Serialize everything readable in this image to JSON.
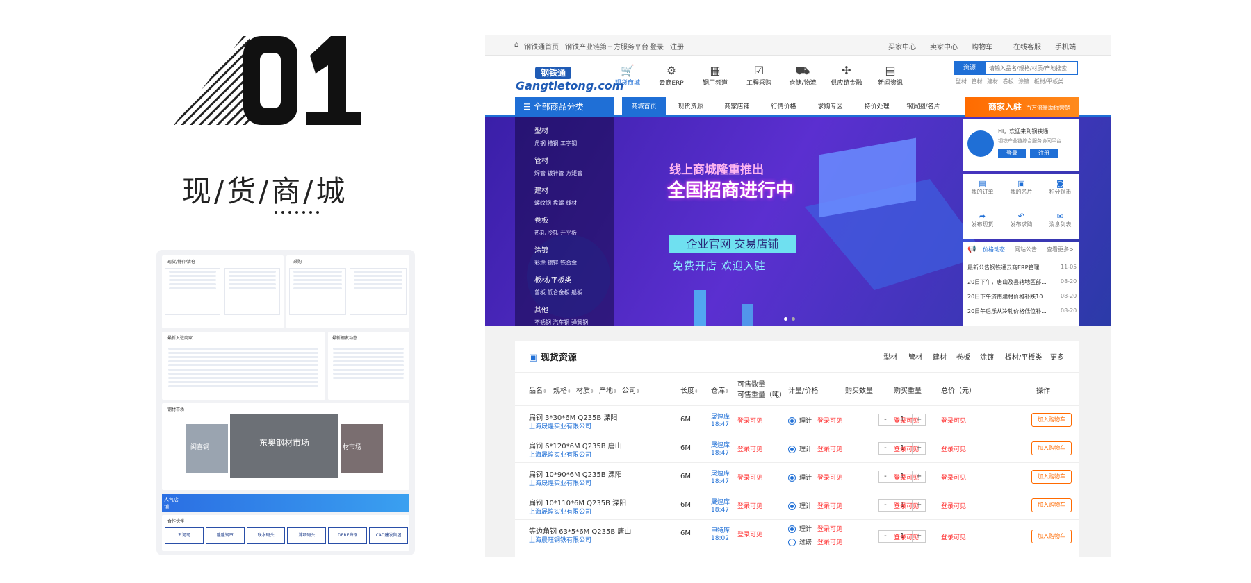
{
  "hero": {
    "title": "现/货/商/城"
  },
  "topbar": {
    "left": [
      "钢铁通首页",
      "钢铁产业链第三方服务平台",
      "登录",
      "注册"
    ],
    "right": [
      "买家中心",
      "卖家中心",
      "购物车",
      "在线客服",
      "手机端"
    ]
  },
  "logo": {
    "cn": "钢铁通",
    "en": "Gangtietong.com"
  },
  "nav_icons": [
    {
      "label": "现货商城",
      "icon": "cart-icon"
    },
    {
      "label": "云商ERP",
      "icon": "gear-icon"
    },
    {
      "label": "钢厂频道",
      "icon": "factory-icon"
    },
    {
      "label": "工程采购",
      "icon": "clipboard-icon"
    },
    {
      "label": "仓储/物流",
      "icon": "truck-icon"
    },
    {
      "label": "供应链金融",
      "icon": "network-icon"
    },
    {
      "label": "新闻资讯",
      "icon": "news-icon"
    }
  ],
  "search": {
    "button": "资源",
    "placeholder": "请输入品名/规格/材质/产地搜索",
    "hot": "型材 管材 建材 卷板 涂镀 板材/平板类"
  },
  "menu": {
    "all": "全部商品分类",
    "items": [
      "商城首页",
      "现货资源",
      "商家店铺",
      "行情价格",
      "求购专区",
      "特价处理",
      "钢贸圈/名片"
    ],
    "merchant": "商家入驻",
    "merchant_sub": "百万流量助你营销"
  },
  "categories": [
    {
      "name": "型材",
      "subs": "角钢 槽钢 工字钢"
    },
    {
      "name": "管材",
      "subs": "焊管 镀锌管 方矩管"
    },
    {
      "name": "建材",
      "subs": "螺纹钢 盘螺 线材"
    },
    {
      "name": "卷板",
      "subs": "热轧 冷轧 开平板"
    },
    {
      "name": "涂镀",
      "subs": "彩涂 镀锌 铁合金"
    },
    {
      "name": "板材/平板类",
      "subs": "普板 低合金板 船板"
    },
    {
      "name": "其他",
      "subs": "不锈钢 汽车钢 弹簧钢"
    }
  ],
  "banner": {
    "t1": "线上商城隆重推出",
    "t2": "全国招商进行中",
    "t3": "企业官网 交易店铺",
    "t4": "免费开店 欢迎入驻"
  },
  "userbox": {
    "hello": "Hi，欢迎来到钢铁通",
    "sub": "钢铁产业链综合服务协同平台",
    "login": "登录",
    "register": "注册",
    "grid": [
      "我的订单",
      "我的名片",
      "积分钢币",
      "发布现货",
      "发布求购",
      "消息列表"
    ],
    "tabs": [
      "价格动态",
      "网站公告",
      "查看更多>"
    ],
    "news": [
      {
        "t": "最新公告钢铁通云商ERP管理...",
        "d": "11-05"
      },
      {
        "t": "20日下午，唐山及县辖地区部...",
        "d": "08-20"
      },
      {
        "t": "20日下午济南建材价格补跌10...",
        "d": "08-20"
      },
      {
        "t": "20日午后乐从冷轧价格低位补...",
        "d": "08-20"
      }
    ]
  },
  "resources": {
    "title": "现货资源",
    "tabs": [
      "型材",
      "管材",
      "建材",
      "卷板",
      "涂镀",
      "板材/平板类",
      "更多"
    ],
    "headers": [
      "品名",
      "规格",
      "材质",
      "产地",
      "公司",
      "长度",
      "仓库",
      "可售数量",
      "可售重量（吨）",
      "计量/价格",
      "购买数量",
      "购买重量",
      "总价（元）",
      "操作"
    ],
    "rows": [
      {
        "name": "扁钢 3*30*6M Q235B 溧阳",
        "co": "上海晟煌实业有限公司",
        "len": "6M",
        "wh": "晟煌库",
        "time": "18:47",
        "stock": "登录可见",
        "m1": "理计",
        "p1": "登录可见",
        "qty": "1",
        "w": "登录可见",
        "total": "登录可见",
        "btn": "加入购物车"
      },
      {
        "name": "扁钢 6*120*6M Q235B 唐山",
        "co": "上海晟煌实业有限公司",
        "len": "6M",
        "wh": "晟煌库",
        "time": "18:47",
        "stock": "登录可见",
        "m1": "理计",
        "p1": "登录可见",
        "qty": "1",
        "w": "登录可见",
        "total": "登录可见",
        "btn": "加入购物车"
      },
      {
        "name": "扁钢 10*90*6M Q235B 溧阳",
        "co": "上海晟煌实业有限公司",
        "len": "6M",
        "wh": "晟煌库",
        "time": "18:47",
        "stock": "登录可见",
        "m1": "理计",
        "p1": "登录可见",
        "qty": "1",
        "w": "登录可见",
        "total": "登录可见",
        "btn": "加入购物车"
      },
      {
        "name": "扁钢 10*110*6M Q235B 溧阳",
        "co": "上海晟煌实业有限公司",
        "len": "6M",
        "wh": "晟煌库",
        "time": "18:47",
        "stock": "登录可见",
        "m1": "理计",
        "p1": "登录可见",
        "qty": "1",
        "w": "登录可见",
        "total": "登录可见",
        "btn": "加入购物车"
      },
      {
        "name": "等边角钢 63*5*6M Q235B 唐山",
        "co": "上海晨旺钢铁有限公司",
        "len": "6M",
        "wh": "申特库",
        "time": "18:02",
        "stock": "登录可见",
        "m1": "理计",
        "p1": "登录可见",
        "m2": "过磅",
        "p2": "登录可见",
        "qty": "1",
        "w": "登录可见",
        "total": "登录可见",
        "btn": "加入购物车"
      }
    ]
  },
  "thumb": {
    "h1": "现货/特价/清仓",
    "h2": "采购",
    "h3": "最新入驻商家",
    "h4": "最新钢友动态",
    "h5": "钢材市场",
    "h6": "合作伙伴",
    "market_main": "东奥钢材市场",
    "market_left": "闽喜钢",
    "market_right": "材市场",
    "hot": "人气店铺",
    "partners": [
      "五河司",
      "隆隆钢市",
      "联水码头",
      "浦项码头",
      "DERE海钢",
      "CAD建发集团"
    ]
  }
}
